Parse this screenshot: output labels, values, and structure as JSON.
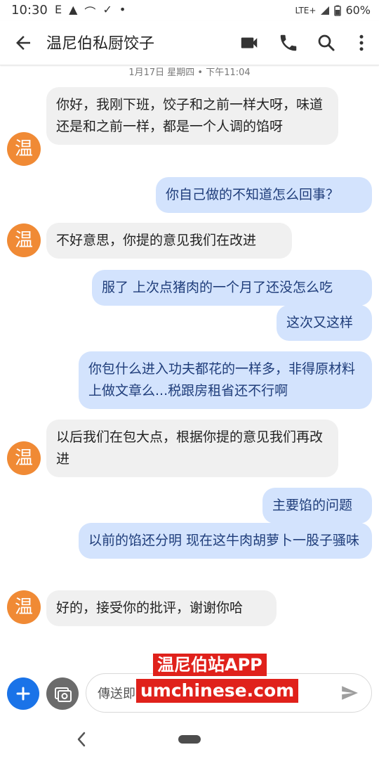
{
  "status_bar": {
    "time": "10:30",
    "left_icons": [
      "E",
      "▲",
      "⌒",
      "✓",
      "•"
    ],
    "network": "LTE+",
    "battery": "60%"
  },
  "app_bar": {
    "title": "温尼伯私厨饺子"
  },
  "conversation": {
    "date_line": "1月17日 星期四 • 下午11:04",
    "avatar_letter": "温",
    "messages": [
      {
        "dir": "in",
        "text": "你好，我刚下班，饺子和之前一样大呀，味道还是和之前一样，都是一个人调的馅呀"
      },
      {
        "dir": "out",
        "text": "你自己做的不知道怎么回事？"
      },
      {
        "dir": "in",
        "text": "不好意思，你提的意见我们在改进"
      },
      {
        "dir": "out",
        "text": "服了 上次点猪肉的一个月了还没怎么吃"
      },
      {
        "dir": "out",
        "text": "这次又这样"
      },
      {
        "dir": "out",
        "text": "你包什么进入功夫都花的一样多，非得原材料上做文章么...税跟房租省还不行啊"
      },
      {
        "dir": "in",
        "text": "以后我们在包大点，根据你提的意见我们再改进"
      },
      {
        "dir": "out",
        "text": "主要馅的问题"
      },
      {
        "dir": "out",
        "text": "以前的馅还分明 现在这牛肉胡萝卜一股子骚味"
      },
      {
        "dir": "in",
        "text": "好的，接受你的批评，谢谢你哈"
      }
    ]
  },
  "compose": {
    "placeholder": "傳送即"
  },
  "watermark": {
    "line1": "温尼伯站APP",
    "line2": "umchinese.com"
  },
  "colors": {
    "avatar": "#f08a35",
    "outgoing_bubble": "#d3e3fd",
    "incoming_bubble": "#f0f0f0",
    "accent": "#1a73e8"
  }
}
